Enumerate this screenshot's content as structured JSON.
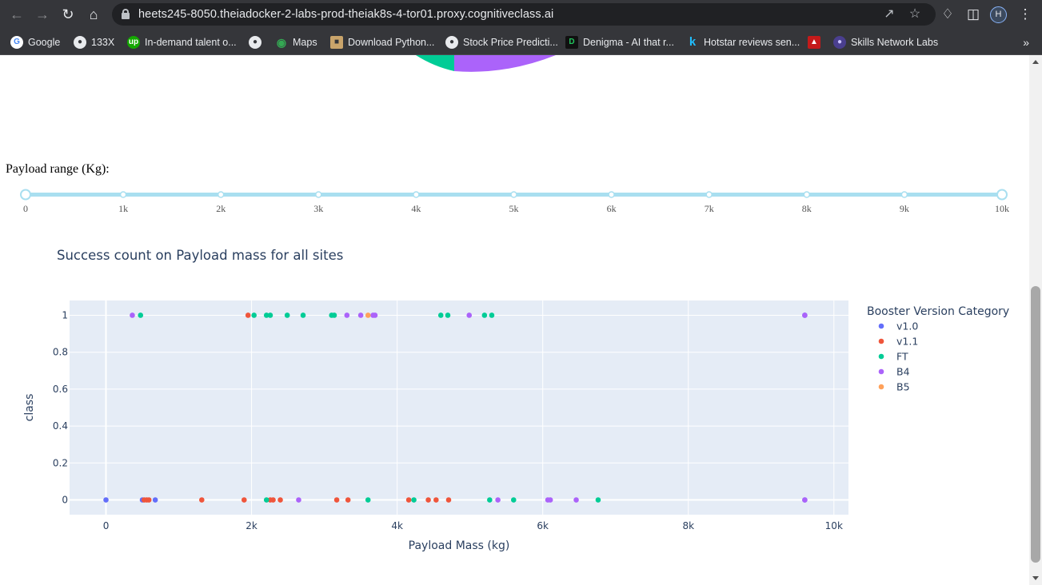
{
  "browser": {
    "url": "heets245-8050.theiadocker-2-labs-prod-theiak8s-4-tor01.proxy.cognitiveclass.ai",
    "profile_initial": "H",
    "bookmarks": [
      {
        "label": "Google",
        "icon": "google-icon",
        "color": "#ffffff"
      },
      {
        "label": "133X",
        "icon": "globe-icon",
        "color": "#e8eaed"
      },
      {
        "label": "In-demand talent o...",
        "icon": "upwork-icon",
        "color": "#14a800"
      },
      {
        "label": "",
        "icon": "globe-icon",
        "color": "#e8eaed"
      },
      {
        "label": "Maps",
        "icon": "maps-icon",
        "color": "#34a853"
      },
      {
        "label": "Download Python...",
        "icon": "python-icon",
        "color": "#c9a46b"
      },
      {
        "label": "Stock Price Predicti...",
        "icon": "globe-icon",
        "color": "#e8eaed"
      },
      {
        "label": "Denigma - AI that r...",
        "icon": "denigma-icon",
        "color": "#22c55e"
      },
      {
        "label": "Hotstar reviews sen...",
        "icon": "kaggle-icon",
        "color": "#20beff"
      },
      {
        "label": "",
        "icon": "pdf-icon",
        "color": "#e02020"
      },
      {
        "label": "Skills Network Labs",
        "icon": "skills-network-icon",
        "color": "#6b5bd6"
      }
    ]
  },
  "slider": {
    "label": "Payload range (Kg):",
    "min": 0,
    "max": 10000,
    "value": [
      0,
      10000
    ],
    "marks": [
      "0",
      "1k",
      "2k",
      "3k",
      "4k",
      "5k",
      "6k",
      "7k",
      "8k",
      "9k",
      "10k"
    ],
    "track_color": "#a9dff0",
    "handle_color": "#a9dff0"
  },
  "colors": {
    "plot_bg": "#e5ecf6",
    "axis_text": "#2a3f5f",
    "v1.0": "#636efa",
    "v1.1": "#ef553b",
    "FT": "#00cc96",
    "B4": "#ab63fa",
    "B5": "#ffa15a"
  },
  "chart_data": {
    "type": "scatter",
    "title": "Success count on Payload mass for all sites",
    "xlabel": "Payload Mass (kg)",
    "ylabel": "class",
    "xlim": [
      -500,
      10200
    ],
    "ylim": [
      -0.08,
      1.08
    ],
    "xticks": [
      0,
      2000,
      4000,
      6000,
      8000,
      10000
    ],
    "xtick_labels": [
      "0",
      "2k",
      "4k",
      "6k",
      "8k",
      "10k"
    ],
    "yticks": [
      0,
      0.2,
      0.4,
      0.6,
      0.8,
      1
    ],
    "ytick_labels": [
      "0",
      "0.2",
      "0.4",
      "0.6",
      "0.8",
      "1"
    ],
    "grid": true,
    "legend_title": "Booster Version Category",
    "legend_position": "right",
    "series": [
      {
        "name": "v1.0",
        "points": [
          [
            0,
            0
          ],
          [
            500,
            0
          ],
          [
            677,
            0
          ],
          [
            9600,
            0
          ],
          [
            9600,
            1
          ]
        ]
      },
      {
        "name": "v1.1",
        "points": [
          [
            525,
            0
          ],
          [
            560,
            0
          ],
          [
            590,
            0
          ],
          [
            1316,
            0
          ],
          [
            1898,
            0
          ],
          [
            1952,
            1
          ],
          [
            2257,
            0
          ],
          [
            2296,
            0
          ],
          [
            2395,
            0
          ],
          [
            3170,
            0
          ],
          [
            3325,
            0
          ],
          [
            4159,
            0
          ],
          [
            4428,
            0
          ],
          [
            4535,
            0
          ],
          [
            4707,
            0
          ]
        ]
      },
      {
        "name": "FT",
        "points": [
          [
            475,
            1
          ],
          [
            2034,
            1
          ],
          [
            2205,
            0
          ],
          [
            2205,
            1
          ],
          [
            2257,
            1
          ],
          [
            2490,
            1
          ],
          [
            2708,
            1
          ],
          [
            3100,
            1
          ],
          [
            3136,
            1
          ],
          [
            3600,
            0
          ],
          [
            4230,
            0
          ],
          [
            4600,
            1
          ],
          [
            4696,
            1
          ],
          [
            5200,
            1
          ],
          [
            5271,
            0
          ],
          [
            5300,
            1
          ],
          [
            5600,
            0
          ],
          [
            6761,
            0
          ]
        ]
      },
      {
        "name": "B4",
        "points": [
          [
            362,
            1
          ],
          [
            2647,
            0
          ],
          [
            3310,
            1
          ],
          [
            3500,
            1
          ],
          [
            3669,
            1
          ],
          [
            3696,
            1
          ],
          [
            4990,
            1
          ],
          [
            5384,
            0
          ],
          [
            6070,
            0
          ],
          [
            6104,
            0
          ],
          [
            6460,
            0
          ],
          [
            9600,
            0
          ],
          [
            9600,
            1
          ]
        ]
      },
      {
        "name": "B5",
        "points": [
          [
            3600,
            1
          ]
        ]
      }
    ]
  }
}
